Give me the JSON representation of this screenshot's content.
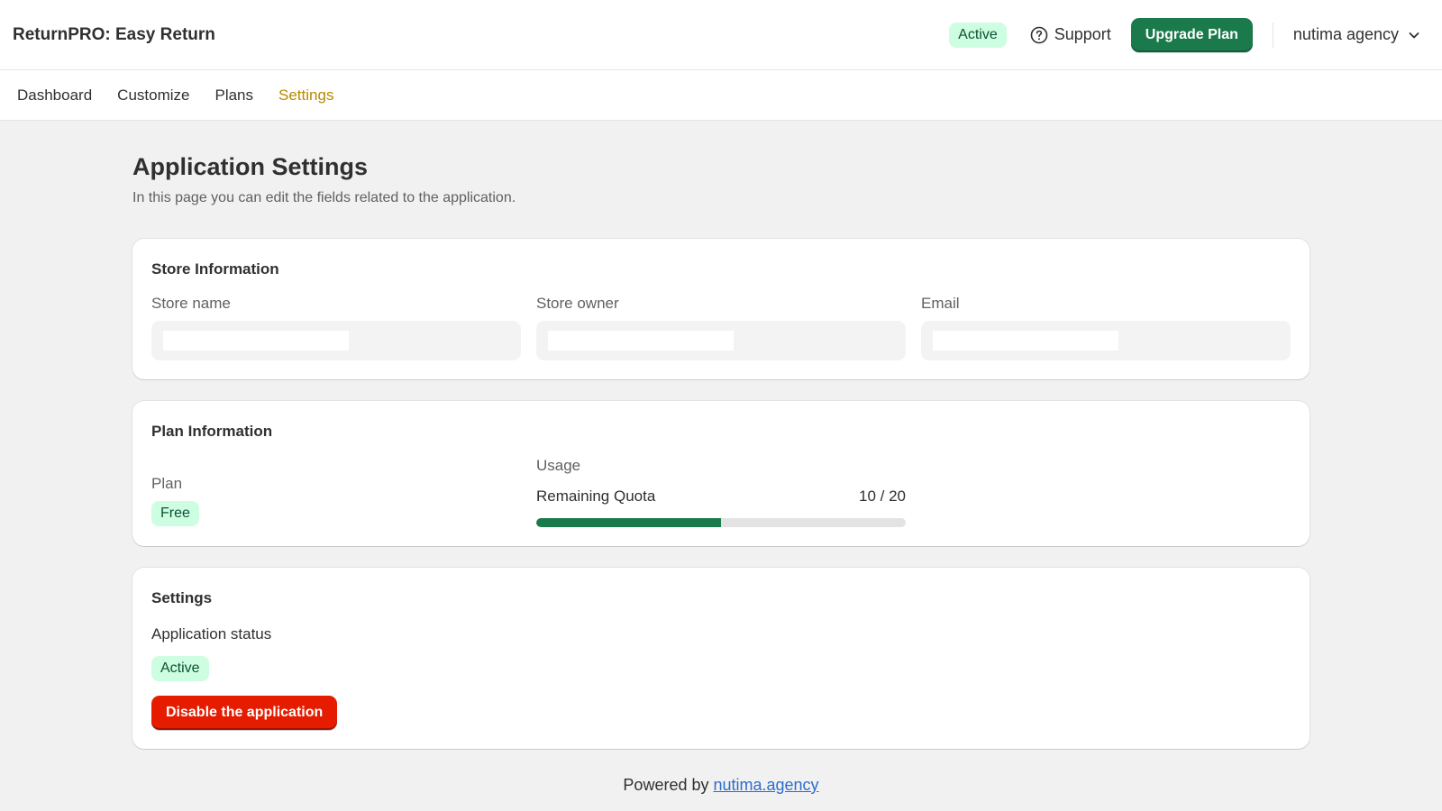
{
  "header": {
    "app_title": "ReturnPRO: Easy Return",
    "status_badge": "Active",
    "support_label": "Support",
    "upgrade_label": "Upgrade Plan",
    "account_name": "nutima agency"
  },
  "nav": {
    "items": [
      {
        "label": "Dashboard",
        "active": false
      },
      {
        "label": "Customize",
        "active": false
      },
      {
        "label": "Plans",
        "active": false
      },
      {
        "label": "Settings",
        "active": true
      }
    ]
  },
  "page": {
    "title": "Application Settings",
    "subtitle": "In this page you can edit the fields related to the application."
  },
  "store_info": {
    "title": "Store Information",
    "fields": [
      {
        "label": "Store name",
        "value": ""
      },
      {
        "label": "Store owner",
        "value": ""
      },
      {
        "label": "Email",
        "value": ""
      }
    ]
  },
  "plan_info": {
    "title": "Plan Information",
    "plan_label": "Plan",
    "plan_value": "Free",
    "usage_label": "Usage",
    "quota_label": "Remaining Quota",
    "quota_text": "10 / 20",
    "quota_used": 10,
    "quota_total": 20
  },
  "settings": {
    "title": "Settings",
    "status_label": "Application status",
    "status_value": "Active",
    "disable_label": "Disable the application"
  },
  "footer": {
    "prefix": "Powered by ",
    "link_text": "nutima.agency"
  },
  "colors": {
    "accent_green": "#1a7a4c",
    "badge_bg": "#cdfee1",
    "danger": "#e51c00",
    "nav_active": "#b98900",
    "link": "#2c6ecb"
  }
}
